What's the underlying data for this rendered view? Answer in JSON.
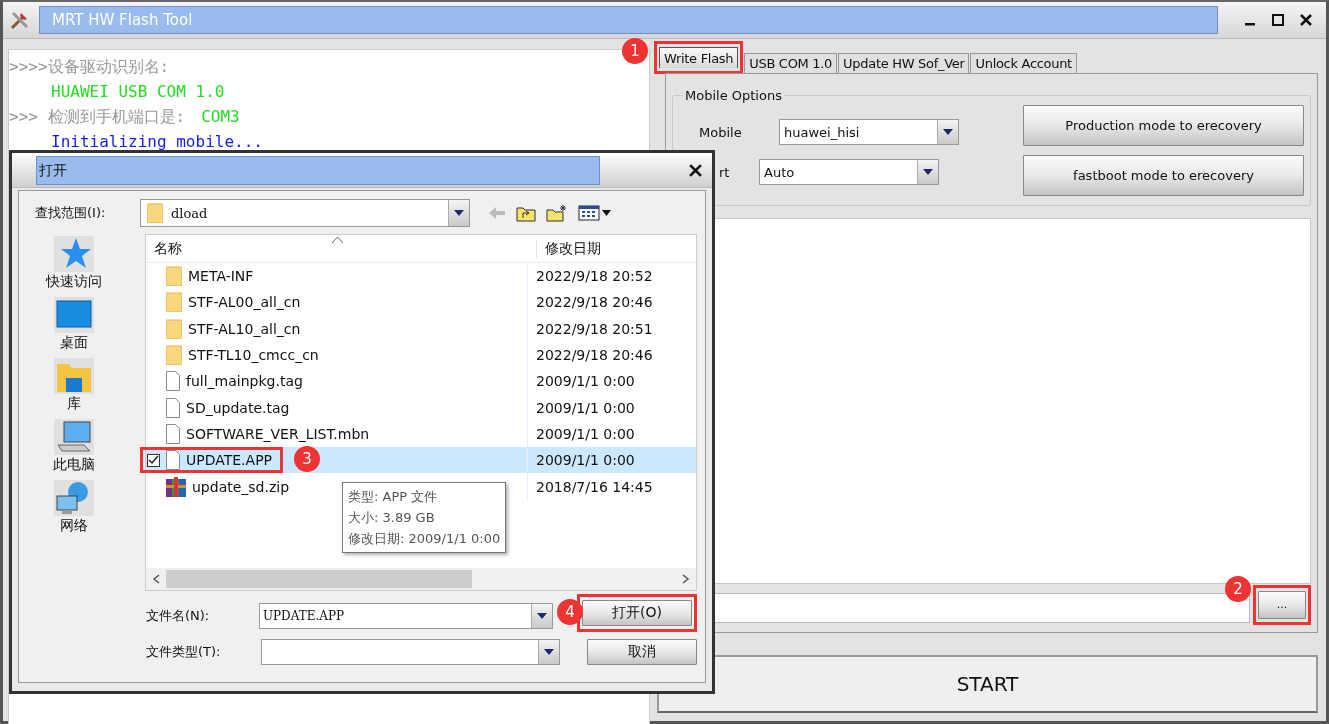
{
  "window": {
    "title": "MRT HW Flash Tool"
  },
  "log": [
    {
      "indent": false,
      "segments": [
        {
          "kind": "prompt",
          "text": ">>>>设备驱动识别名:"
        }
      ]
    },
    {
      "indent": true,
      "segments": [
        {
          "kind": "value",
          "text": "HUAWEI USB COM 1.0"
        }
      ]
    },
    {
      "indent": false,
      "segments": [
        {
          "kind": "prompt",
          "text": ">>> 检测到手机端口是:"
        },
        {
          "kind": "value",
          "text": "COM3"
        }
      ]
    },
    {
      "indent": true,
      "segments": [
        {
          "kind": "info",
          "text": "Initializing mobile..."
        }
      ]
    }
  ],
  "tabs": [
    {
      "label": "Write Flash",
      "selected": true,
      "highlighted": true
    },
    {
      "label": "USB COM 1.0",
      "selected": false,
      "highlighted": false
    },
    {
      "label": "Update HW Sof_Ver",
      "selected": false,
      "highlighted": false
    },
    {
      "label": "Unlock Account",
      "selected": false,
      "highlighted": false
    }
  ],
  "mobile_options": {
    "title": "Mobile Options",
    "fields": [
      {
        "label": "Mobile",
        "value": "huawei_hisi",
        "cut": false
      },
      {
        "label": "rt",
        "value": "Auto",
        "cut": true
      }
    ],
    "buttons": [
      "Production mode to erecovery",
      "fastboot mode to erecovery"
    ]
  },
  "browse_button": {
    "label": "...",
    "highlighted": true
  },
  "start_button": {
    "label": "START"
  },
  "dialog": {
    "title": "打开",
    "look_in": {
      "label": "查找范围(I):",
      "value": "dload"
    },
    "places": [
      {
        "kind": "star",
        "label": "快速访问"
      },
      {
        "kind": "desktop",
        "label": "桌面"
      },
      {
        "kind": "library",
        "label": "库"
      },
      {
        "kind": "computer",
        "label": "此电脑"
      },
      {
        "kind": "network",
        "label": "网络"
      }
    ],
    "columns": [
      "名称",
      "修改日期"
    ],
    "files": [
      {
        "kind": "folder",
        "name": "META-INF",
        "date": "2022/9/18 20:52",
        "selected": false,
        "checked": false,
        "highlighted": false
      },
      {
        "kind": "folder",
        "name": "STF-AL00_all_cn",
        "date": "2022/9/18 20:46",
        "selected": false,
        "checked": false,
        "highlighted": false
      },
      {
        "kind": "folder",
        "name": "STF-AL10_all_cn",
        "date": "2022/9/18 20:51",
        "selected": false,
        "checked": false,
        "highlighted": false
      },
      {
        "kind": "folder",
        "name": "STF-TL10_cmcc_cn",
        "date": "2022/9/18 20:46",
        "selected": false,
        "checked": false,
        "highlighted": false
      },
      {
        "kind": "file",
        "name": "full_mainpkg.tag",
        "date": "2009/1/1 0:00",
        "selected": false,
        "checked": false,
        "highlighted": false
      },
      {
        "kind": "file",
        "name": "SD_update.tag",
        "date": "2009/1/1 0:00",
        "selected": false,
        "checked": false,
        "highlighted": false
      },
      {
        "kind": "file",
        "name": "SOFTWARE_VER_LIST.mbn",
        "date": "2009/1/1 0:00",
        "selected": false,
        "checked": false,
        "highlighted": false
      },
      {
        "kind": "file",
        "name": "UPDATE.APP",
        "date": "2009/1/1 0:00",
        "selected": true,
        "checked": true,
        "highlighted": true
      },
      {
        "kind": "archive",
        "name": "update_sd.zip",
        "date": "2018/7/16 14:45",
        "selected": false,
        "checked": false,
        "highlighted": false
      }
    ],
    "tooltip": [
      "类型: APP 文件",
      "大小: 3.89 GB",
      "修改日期: 2009/1/1 0:00"
    ],
    "file_name": {
      "label": "文件名(N):",
      "value": "UPDATE.APP"
    },
    "file_type": {
      "label": "文件类型(T):"
    },
    "open_button": {
      "label": "打开(O)",
      "highlighted": true
    },
    "cancel_button": {
      "label": "取消"
    }
  },
  "annotations": [
    {
      "label": "1"
    },
    {
      "label": "2"
    },
    {
      "label": "3"
    },
    {
      "label": "4"
    }
  ]
}
